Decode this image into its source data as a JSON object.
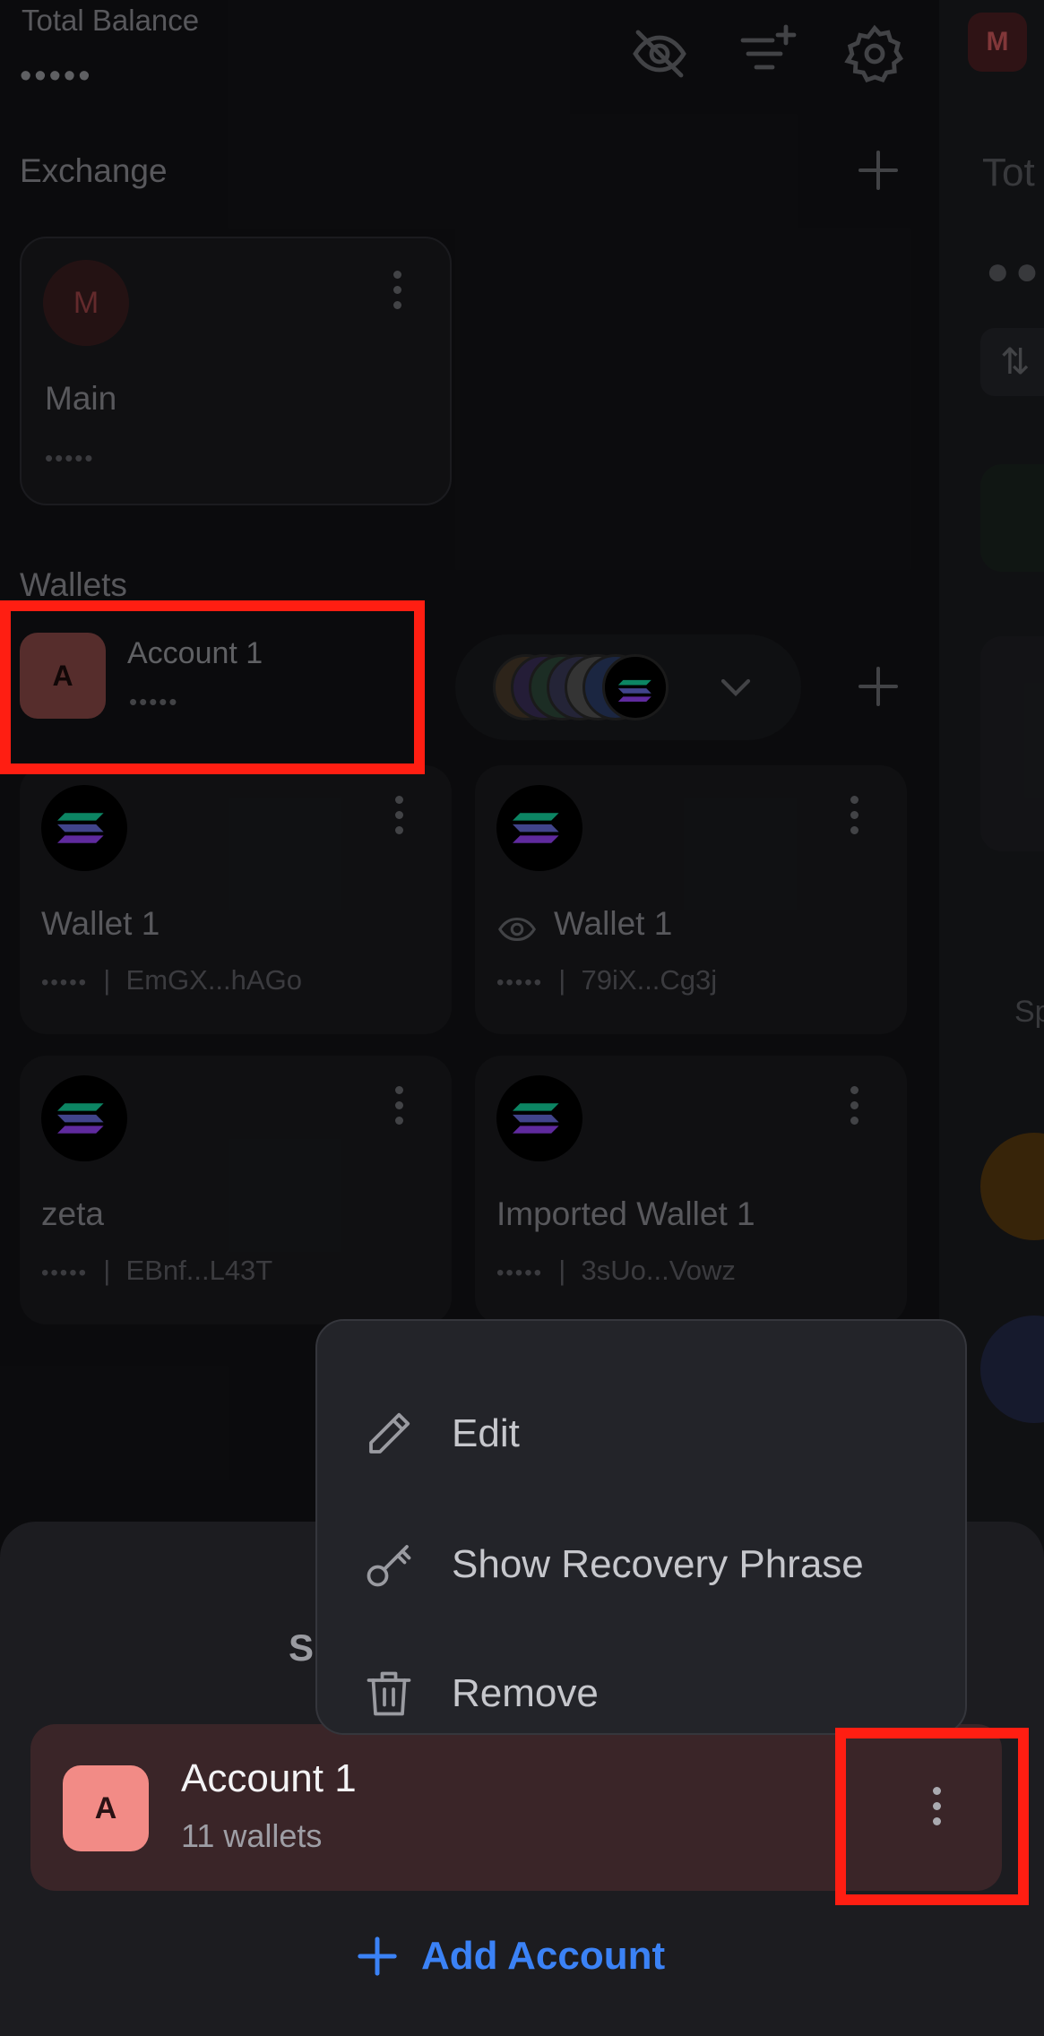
{
  "header": {
    "total_balance_label": "Total Balance",
    "total_balance_value": "•••••"
  },
  "exchange": {
    "section_label": "Exchange",
    "card": {
      "avatar_letter": "M",
      "name": "Main",
      "balance": "•••••"
    }
  },
  "wallets": {
    "section_label": "Wallets",
    "account": {
      "avatar_letter": "A",
      "name": "Account 1",
      "balance": "•••••"
    },
    "items": [
      {
        "name": "Wallet 1",
        "balance": "•••••",
        "address": "EmGX...hAGo",
        "watch": false
      },
      {
        "name": "Wallet 1",
        "balance": "•••••",
        "address": "79iX...Cg3j",
        "watch": true
      },
      {
        "name": "zeta",
        "balance": "•••••",
        "address": "EBnf...L43T",
        "watch": false
      },
      {
        "name": "Imported Wallet 1",
        "balance": "•••••",
        "address": "3sUo...Vowz",
        "watch": false
      }
    ]
  },
  "right_peek": {
    "avatar_letter": "M",
    "title_fragment": "Tot",
    "section_fragment": "Sp"
  },
  "sheet": {
    "title_fragment": "S",
    "account": {
      "avatar_letter": "A",
      "name": "Account 1",
      "wallet_count": "11 wallets"
    },
    "add_account_label": "Add Account"
  },
  "menu": {
    "items": [
      {
        "label": "Edit",
        "icon": "pencil-icon"
      },
      {
        "label": "Show Recovery Phrase",
        "icon": "key-icon"
      },
      {
        "label": "Remove",
        "icon": "trash-icon"
      }
    ]
  },
  "colors": {
    "background": "#131316",
    "accent_blue": "#3b82f6",
    "highlight_red": "#ff1e12",
    "account_avatar": "#f28b86"
  }
}
